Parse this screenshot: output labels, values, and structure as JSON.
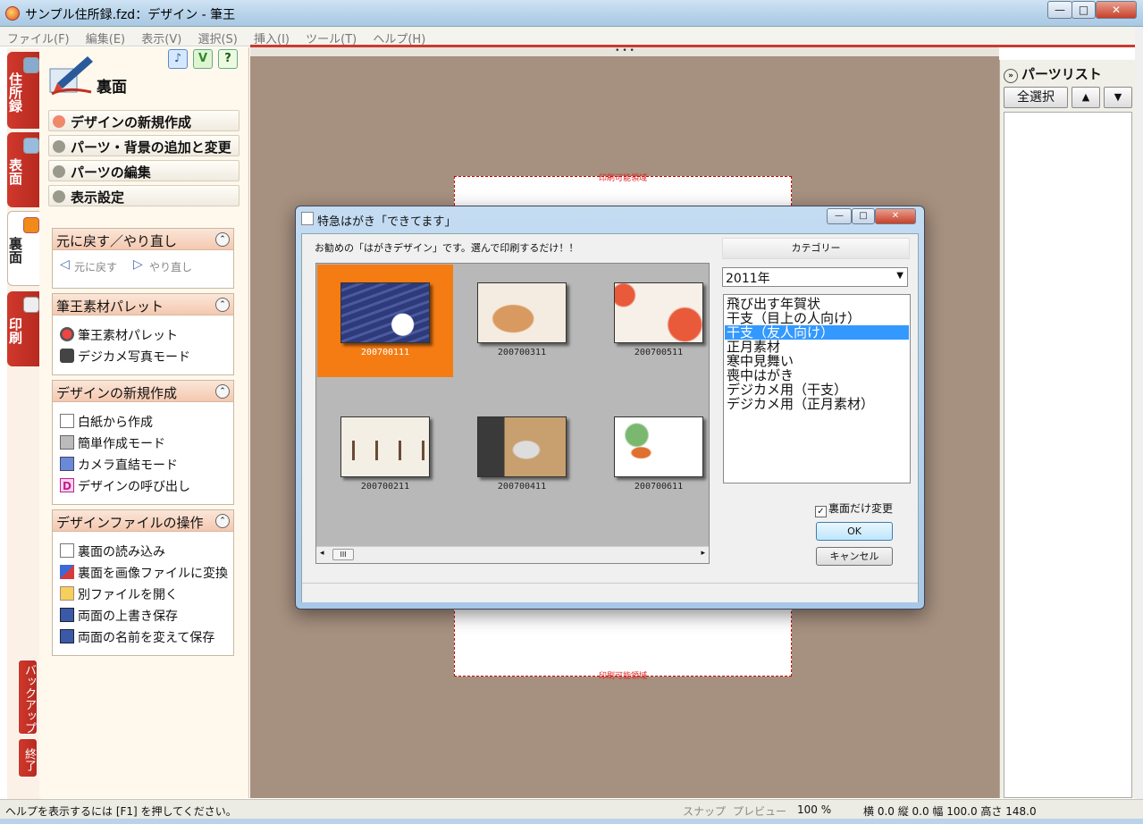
{
  "window": {
    "title": "サンプル住所録.fzd：デザイン - 筆王",
    "controls": {
      "minimize": "—",
      "maximize": "□",
      "close": "✕"
    }
  },
  "menubar": [
    "ファイル(F)",
    "編集(E)",
    "表示(V)",
    "選択(S)",
    "挿入(I)",
    "ツール(T)",
    "ヘルプ(H)"
  ],
  "side_tabs": [
    {
      "label": "住所録",
      "active": false
    },
    {
      "label": "表面",
      "active": false
    },
    {
      "label": "裏面",
      "active": true
    },
    {
      "label": "印刷",
      "active": false
    }
  ],
  "side_bottom": {
    "backup": "バックアップ",
    "exit": "終了"
  },
  "left_panel": {
    "title": "裏面",
    "top_icons": {
      "sound": "♪",
      "beginner": "V",
      "help": "?"
    },
    "nav": [
      {
        "label": "デザインの新規作成",
        "selected": true
      },
      {
        "label": "パーツ・背景の追加と変更",
        "selected": false
      },
      {
        "label": "パーツの編集",
        "selected": false
      },
      {
        "label": "表示設定",
        "selected": false
      }
    ],
    "groups": {
      "undo": {
        "title": "元に戻す／やり直し",
        "undo": "元に戻す",
        "redo": "やり直し"
      },
      "palette": {
        "title": "筆王素材パレット",
        "items": [
          "筆王素材パレット",
          "デジカメ写真モード"
        ]
      },
      "new_design": {
        "title": "デザインの新規作成",
        "items": [
          "白紙から作成",
          "簡単作成モード",
          "カメラ直結モード",
          "デザインの呼び出し"
        ]
      },
      "file_ops": {
        "title": "デザインファイルの操作",
        "items": [
          "裏面の読み込み",
          "裏面を画像ファイルに変換",
          "別ファイルを開く",
          "両面の上書き保存",
          "両面の名前を変えて保存"
        ]
      }
    }
  },
  "canvas": {
    "print_area_top": "印刷可能領域",
    "print_area_bottom": "印刷可能領域",
    "splitter": "• • •"
  },
  "parts_panel": {
    "title": "パーツリスト",
    "collapse_icon": "»",
    "select_all": "全選択",
    "up": "▲",
    "down": "▼"
  },
  "dialog": {
    "title": "特急はがき「できてます」",
    "intro": "お勧めの「はがきデザイン」です。選んで印刷するだけ！！",
    "category_label": "カテゴリー",
    "year": "2011年",
    "categories": [
      {
        "label": "飛び出す年賀状",
        "selected": false
      },
      {
        "label": "干支（目上の人向け）",
        "selected": false
      },
      {
        "label": "干支（友人向け）",
        "selected": true
      },
      {
        "label": "正月素材",
        "selected": false
      },
      {
        "label": "寒中見舞い",
        "selected": false
      },
      {
        "label": "喪中はがき",
        "selected": false
      },
      {
        "label": "デジカメ用（干支）",
        "selected": false
      },
      {
        "label": "デジカメ用（正月素材）",
        "selected": false
      }
    ],
    "thumbnails": [
      {
        "code": "200700111",
        "selected": true,
        "colors": [
          "#2e3a7a",
          "#ffffff"
        ]
      },
      {
        "code": "200700311",
        "selected": false,
        "colors": [
          "#d89a60",
          "#f4ece0"
        ]
      },
      {
        "code": "200700511",
        "selected": false,
        "colors": [
          "#e85a3a",
          "#f6f0e8"
        ]
      },
      {
        "code": "200700211",
        "selected": false,
        "colors": [
          "#6a4a38",
          "#f4efe4"
        ]
      },
      {
        "code": "200700411",
        "selected": false,
        "colors": [
          "#3a3a3a",
          "#c8a070"
        ]
      },
      {
        "code": "200700611",
        "selected": false,
        "colors": [
          "#e07030",
          "#ffffff"
        ]
      }
    ],
    "back_only_checkbox": {
      "label": "裏面だけ変更",
      "checked": true
    },
    "ok": "OK",
    "cancel": "キャンセル",
    "scroll_thumb": "III"
  },
  "statusbar": {
    "help": "ヘルプを表示するには [F1] を押してください。",
    "snap": "スナップ",
    "preview": "プレビュー",
    "zoom": "100 %",
    "coords": "横 0.0 縦 0.0 幅 100.0 高さ 148.0"
  },
  "colors": {
    "accent_red": "#c83b30",
    "selection": "#f57c12",
    "list_highlight": "#3399ff",
    "workspace": "#a6907f"
  }
}
